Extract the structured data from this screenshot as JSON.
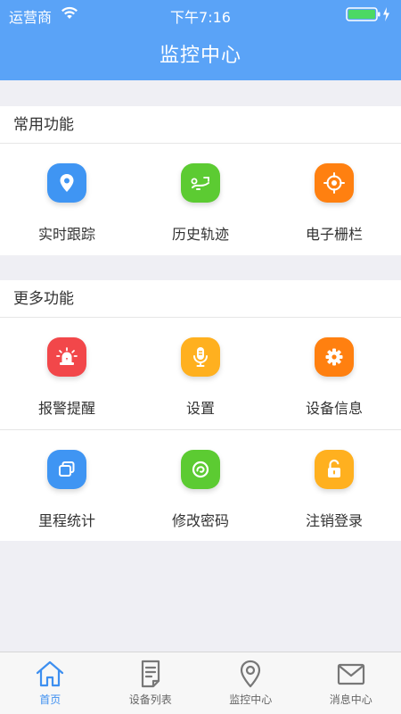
{
  "status_bar": {
    "carrier": "运营商",
    "time": "下午7:16"
  },
  "nav": {
    "title": "监控中心"
  },
  "sections": [
    {
      "title": "常用功能",
      "items": [
        {
          "label": "实时跟踪",
          "icon": "location-pin-icon",
          "color": "#3f95f3"
        },
        {
          "label": "历史轨迹",
          "icon": "route-icon",
          "color": "#5ccb32"
        },
        {
          "label": "电子栅栏",
          "icon": "crosshair-icon",
          "color": "#ff8010"
        }
      ]
    },
    {
      "title": "更多功能",
      "items": [
        {
          "label": "报警提醒",
          "icon": "alarm-siren-icon",
          "color": "#f2474a"
        },
        {
          "label": "设置",
          "icon": "microphone-icon",
          "color": "#ffb01f"
        },
        {
          "label": "设备信息",
          "icon": "gear-icon",
          "color": "#ff8010"
        },
        {
          "label": "里程统计",
          "icon": "windows-icon",
          "color": "#3f95f3"
        },
        {
          "label": "修改密码",
          "icon": "swirl-icon",
          "color": "#5ccb32"
        },
        {
          "label": "注销登录",
          "icon": "unlock-icon",
          "color": "#ffb01f"
        }
      ]
    }
  ],
  "tabs": [
    {
      "label": "首页",
      "icon": "home-icon",
      "active": true
    },
    {
      "label": "设备列表",
      "icon": "document-list-icon",
      "active": false
    },
    {
      "label": "监控中心",
      "icon": "map-pin-icon",
      "active": false
    },
    {
      "label": "消息中心",
      "icon": "mail-icon",
      "active": false
    }
  ],
  "colors": {
    "header": "#5aa3f7",
    "tab_active": "#3d8ff0",
    "tab_inactive": "#666666",
    "battery": "#4cd964"
  }
}
